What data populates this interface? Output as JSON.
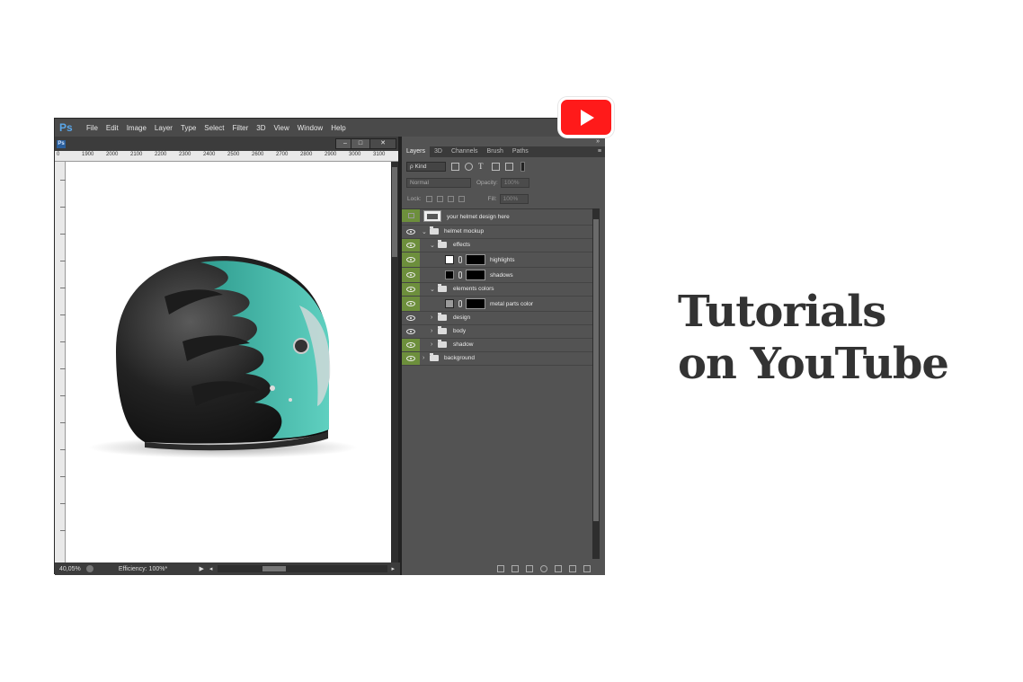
{
  "app": {
    "logo": "Ps"
  },
  "menubar": {
    "items": [
      "File",
      "Edit",
      "Image",
      "Layer",
      "Type",
      "Select",
      "Filter",
      "3D",
      "View",
      "Window",
      "Help"
    ]
  },
  "document": {
    "ps_icon": "Ps",
    "window_buttons": {
      "minimize": "–",
      "maximize": "□",
      "close": "✕"
    },
    "ruler_h": [
      "0",
      "1900",
      "2000",
      "2100",
      "2200",
      "2300",
      "2400",
      "2500",
      "2600",
      "2700",
      "2800",
      "2900",
      "3000",
      "3100"
    ]
  },
  "status": {
    "zoom": "40,05%",
    "efficiency": "Efficiency: 100%*",
    "arrow": "▶",
    "scroll_left": "◂",
    "scroll_right": "▸"
  },
  "panel": {
    "tabs": [
      "Layers",
      "3D",
      "Channels",
      "Brush",
      "Paths"
    ],
    "active_tab": "Layers",
    "collapse": "»",
    "menu": "≡",
    "kind_label": "ρ Kind",
    "blend_mode": "Normal",
    "opacity_label": "Opacity:",
    "opacity_value": "100%",
    "lock_label": "Lock:",
    "fill_label": "Fill:",
    "fill_value": "100%",
    "type_tool": "T",
    "layers": [
      {
        "name": "your helmet design here",
        "visible": false,
        "kind": "smart-object",
        "indent": 0
      },
      {
        "name": "helmet mockup",
        "visible": true,
        "kind": "group-open",
        "indent": 0
      },
      {
        "name": "effects",
        "visible": true,
        "kind": "group-open",
        "indent": 1
      },
      {
        "name": "highlights",
        "visible": true,
        "kind": "adjustment-white",
        "indent": 2
      },
      {
        "name": "shadows",
        "visible": true,
        "kind": "adjustment-black",
        "indent": 2
      },
      {
        "name": "elements colors",
        "visible": true,
        "kind": "group-open",
        "indent": 1
      },
      {
        "name": "metal parts color",
        "visible": true,
        "kind": "adjustment-gray",
        "indent": 2
      },
      {
        "name": "design",
        "visible": true,
        "kind": "group-closed",
        "indent": 1
      },
      {
        "name": "body",
        "visible": true,
        "kind": "group-closed",
        "indent": 1
      },
      {
        "name": "shadow",
        "visible": true,
        "kind": "group-closed",
        "indent": 1
      },
      {
        "name": "background",
        "visible": true,
        "kind": "group-closed",
        "indent": 0
      }
    ],
    "footer_icons": [
      "link-icon",
      "fx-icon",
      "mask-icon",
      "adjustment-icon",
      "folder-icon",
      "new-layer-icon",
      "trash-icon"
    ]
  },
  "headline": {
    "line1": "Tutorials",
    "line2": "on YouTube"
  },
  "colors": {
    "youtube_red": "#ff1a1a",
    "helmet_teal": "#3fb8a8",
    "helmet_black": "#1c1c1c",
    "eye_column_green": "#6d8f3c",
    "headline": "#333333"
  }
}
